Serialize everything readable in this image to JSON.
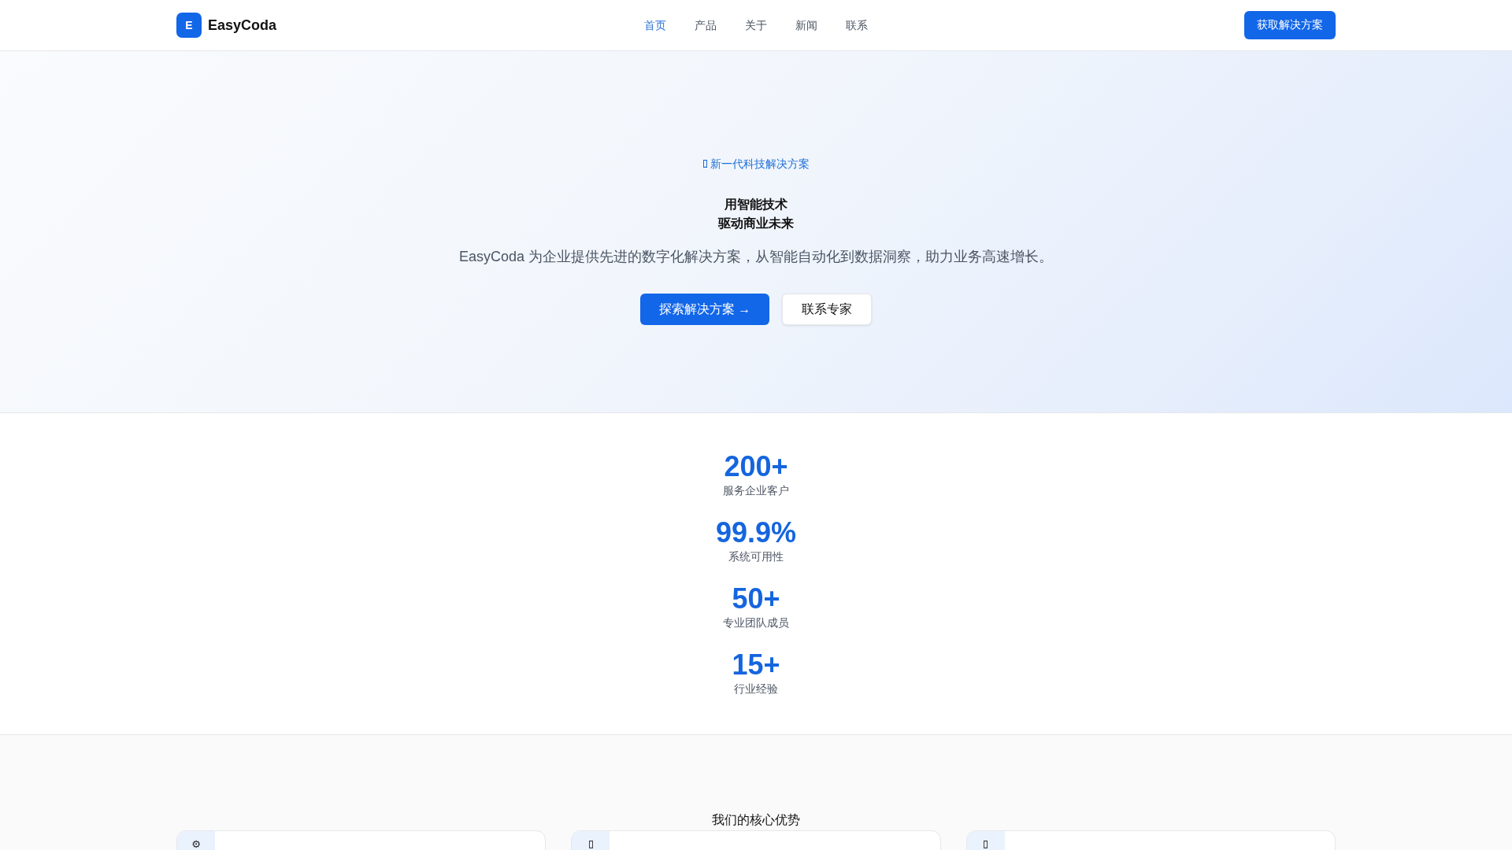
{
  "header": {
    "brand": {
      "mark": "E",
      "name": "EasyCoda"
    },
    "nav": [
      {
        "label": "首页",
        "selected": true
      },
      {
        "label": "产品",
        "selected": false
      },
      {
        "label": "关于",
        "selected": false
      },
      {
        "label": "新闻",
        "selected": false
      },
      {
        "label": "联系",
        "selected": false
      }
    ],
    "cta_button": "获取解决方案"
  },
  "hero": {
    "badge": "新一代科技解决方案",
    "title": [
      "用智能技术",
      "驱动商业未来"
    ],
    "description": "EasyCoda 为企业提供先进的数字化解决方案，从智能自动化到数据洞察，助力业务高速增长。",
    "buttons": [
      {
        "label": "探索解决方案 →",
        "kind": "primary"
      },
      {
        "label": "联系专家",
        "kind": "secondary"
      }
    ]
  },
  "stats": [
    {
      "value": "200+",
      "label": "服务企业客户"
    },
    {
      "value": "99.9%",
      "label": "系统可用性"
    },
    {
      "value": "50+",
      "label": "专业团队成员"
    },
    {
      "value": "15+",
      "label": "行业经验"
    }
  ],
  "features": {
    "title": "我们的核心优势",
    "cards": [
      {
        "kind": "symbol",
        "icon": "⚙"
      },
      {
        "kind": "missing_glyph"
      },
      {
        "kind": "missing_glyph"
      }
    ]
  }
}
